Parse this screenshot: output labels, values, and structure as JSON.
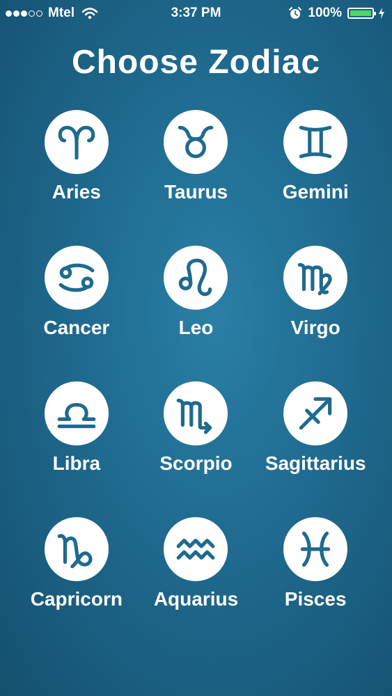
{
  "status_bar": {
    "carrier": "Mtel",
    "time": "3:37 PM",
    "battery_percent": "100%",
    "signal_bars": 3,
    "battery_color": "#4cd964"
  },
  "title": "Choose Zodiac",
  "signs": [
    {
      "label": "Aries",
      "icon": "aries-icon"
    },
    {
      "label": "Taurus",
      "icon": "taurus-icon"
    },
    {
      "label": "Gemini",
      "icon": "gemini-icon"
    },
    {
      "label": "Cancer",
      "icon": "cancer-icon"
    },
    {
      "label": "Leo",
      "icon": "leo-icon"
    },
    {
      "label": "Virgo",
      "icon": "virgo-icon"
    },
    {
      "label": "Libra",
      "icon": "libra-icon"
    },
    {
      "label": "Scorpio",
      "icon": "scorpio-icon"
    },
    {
      "label": "Sagittarius",
      "icon": "sagittarius-icon"
    },
    {
      "label": "Capricorn",
      "icon": "capricorn-icon"
    },
    {
      "label": "Aquarius",
      "icon": "aquarius-icon"
    },
    {
      "label": "Pisces",
      "icon": "pisces-icon"
    }
  ],
  "colors": {
    "background": "#1f6a8f",
    "icon_fill": "#ffffff",
    "glyph": "#1f6a8f"
  }
}
